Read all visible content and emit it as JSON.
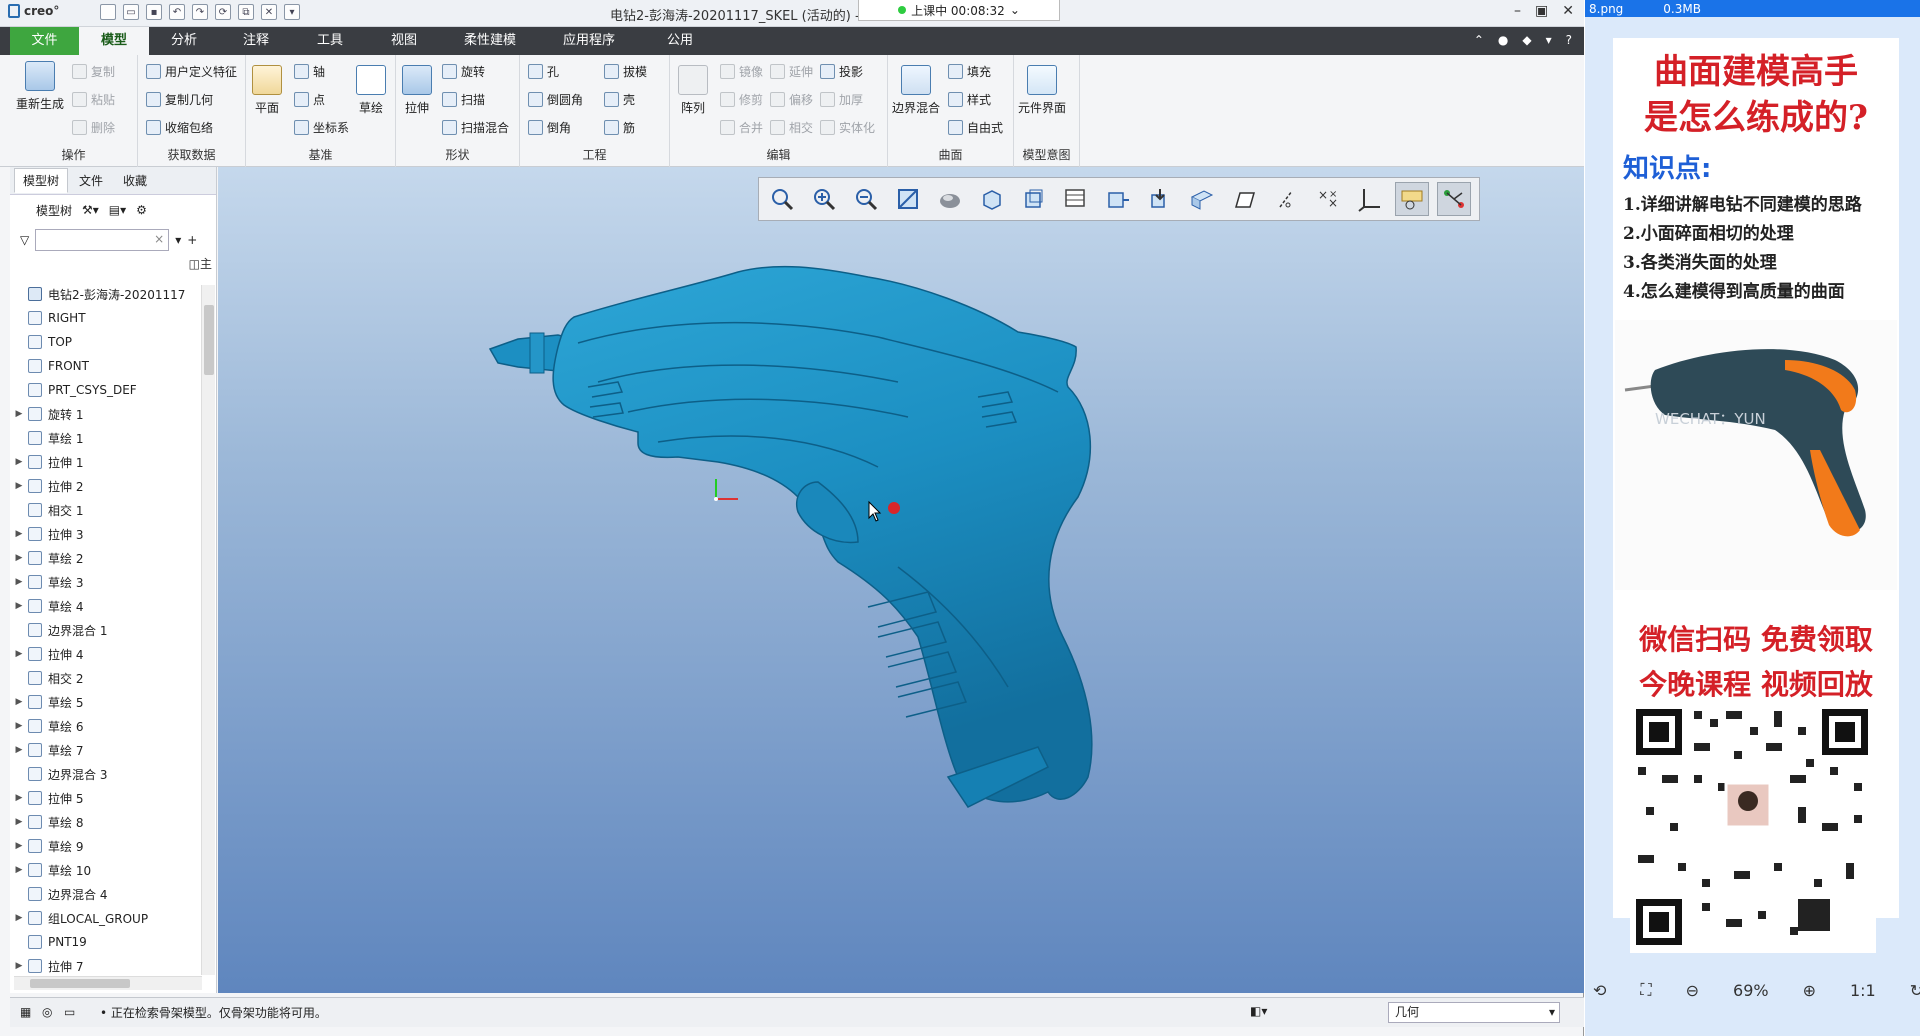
{
  "titlebar": {
    "logo": "creo°",
    "title": "电钻2-彭海涛-20201117_SKEL (活动的) -",
    "recording": "上课中 00:08:32"
  },
  "menu": {
    "file": "文件",
    "tabs": [
      "模型",
      "分析",
      "注释",
      "工具",
      "视图",
      "柔性建模",
      "应用程序",
      "公用"
    ]
  },
  "ribbon": {
    "groups": {
      "operation": "操作",
      "get_data": "获取数据",
      "datum": "基准",
      "shapes": "形状",
      "engineering": "工程",
      "edit": "编辑",
      "surface": "曲面",
      "model_intent": "模型意图"
    },
    "regenerate": "重新生成",
    "copy": "复制",
    "paste": "粘贴",
    "delete": "删除",
    "user_feature": "用户定义特征",
    "copy_geom": "复制几何",
    "shrinkwrap": "收缩包络",
    "plane": "平面",
    "axis": "轴",
    "point": "点",
    "csys": "坐标系",
    "sketch": "草绘",
    "extrude": "拉伸",
    "revolve": "旋转",
    "sweep": "扫描",
    "swept_blend": "扫描混合",
    "hole": "孔",
    "draft": "拔模",
    "round": "倒圆角",
    "shell": "壳",
    "chamfer": "倒角",
    "rib": "筋",
    "pattern": "阵列",
    "mirror": "镜像",
    "extend": "延伸",
    "project": "投影",
    "trim": "修剪",
    "offset": "偏移",
    "thicken": "加厚",
    "merge": "合并",
    "intersect": "相交",
    "solidify": "实体化",
    "boundary_blend": "边界混合",
    "fill": "填充",
    "style": "样式",
    "freestyle": "自由式",
    "component_interface": "元件界面"
  },
  "leftpanel": {
    "tabs": [
      "模型树",
      "文件",
      "收藏"
    ],
    "tree_label": "模型树",
    "header": "主",
    "items": [
      {
        "label": "电钻2-彭海涛-20201117",
        "expand": ""
      },
      {
        "label": "RIGHT",
        "expand": ""
      },
      {
        "label": "TOP",
        "expand": ""
      },
      {
        "label": "FRONT",
        "expand": ""
      },
      {
        "label": "PRT_CSYS_DEF",
        "expand": ""
      },
      {
        "label": "旋转 1",
        "expand": "▶"
      },
      {
        "label": "草绘 1",
        "expand": ""
      },
      {
        "label": "拉伸 1",
        "expand": "▶"
      },
      {
        "label": "拉伸 2",
        "expand": "▶"
      },
      {
        "label": "相交 1",
        "expand": ""
      },
      {
        "label": "拉伸 3",
        "expand": "▶"
      },
      {
        "label": "草绘 2",
        "expand": "▶"
      },
      {
        "label": "草绘 3",
        "expand": "▶"
      },
      {
        "label": "草绘 4",
        "expand": "▶"
      },
      {
        "label": "边界混合 1",
        "expand": ""
      },
      {
        "label": "拉伸 4",
        "expand": "▶"
      },
      {
        "label": "相交 2",
        "expand": ""
      },
      {
        "label": "草绘 5",
        "expand": "▶"
      },
      {
        "label": "草绘 6",
        "expand": "▶"
      },
      {
        "label": "草绘 7",
        "expand": "▶"
      },
      {
        "label": "边界混合 3",
        "expand": ""
      },
      {
        "label": "拉伸 5",
        "expand": "▶"
      },
      {
        "label": "草绘 8",
        "expand": "▶"
      },
      {
        "label": "草绘 9",
        "expand": "▶"
      },
      {
        "label": "草绘 10",
        "expand": "▶"
      },
      {
        "label": "边界混合 4",
        "expand": ""
      },
      {
        "label": "组LOCAL_GROUP",
        "expand": "▶"
      },
      {
        "label": "PNT19",
        "expand": ""
      },
      {
        "label": "拉伸 7",
        "expand": "▶"
      }
    ]
  },
  "viewtoolbar": {
    "icons": [
      "zoom-fit-icon",
      "zoom-in-icon",
      "zoom-out-icon",
      "repaint-icon",
      "display-style-icon",
      "saved-views-icon",
      "view-normal-icon",
      "view-manager-icon",
      "perspective-icon",
      "spin-center-icon",
      "annotation-display-icon",
      "plane-display-icon",
      "axis-display-icon",
      "point-display-icon",
      "csys-display-icon",
      "view-orient-icon",
      "feature-display-icon"
    ]
  },
  "statusbar": {
    "message": "• 正在检索骨架模型。仅骨架功能将可用。",
    "filter": "几何"
  },
  "ad": {
    "topbar_file": "8.png",
    "topbar_size": "0.3MB",
    "headline1": "曲面建模高手",
    "headline2": "是怎么练成的?",
    "knowledge": "知识点:",
    "points": [
      "1.详细讲解电钻不同建模的思路",
      "2.小面碎面相切的处理",
      "3.各类消失面的处理",
      "4.怎么建模得到高质量的曲面"
    ],
    "watermark": "WECHAT：YUN",
    "scan": "微信扫码  免费领取",
    "tonight": "今晚课程  视频回放",
    "zoom": "69%",
    "one_to_one": "1:1"
  },
  "colors": {
    "model": "#1f8fbf",
    "file_tab": "#3ea63f",
    "accent_red": "#d42027"
  }
}
